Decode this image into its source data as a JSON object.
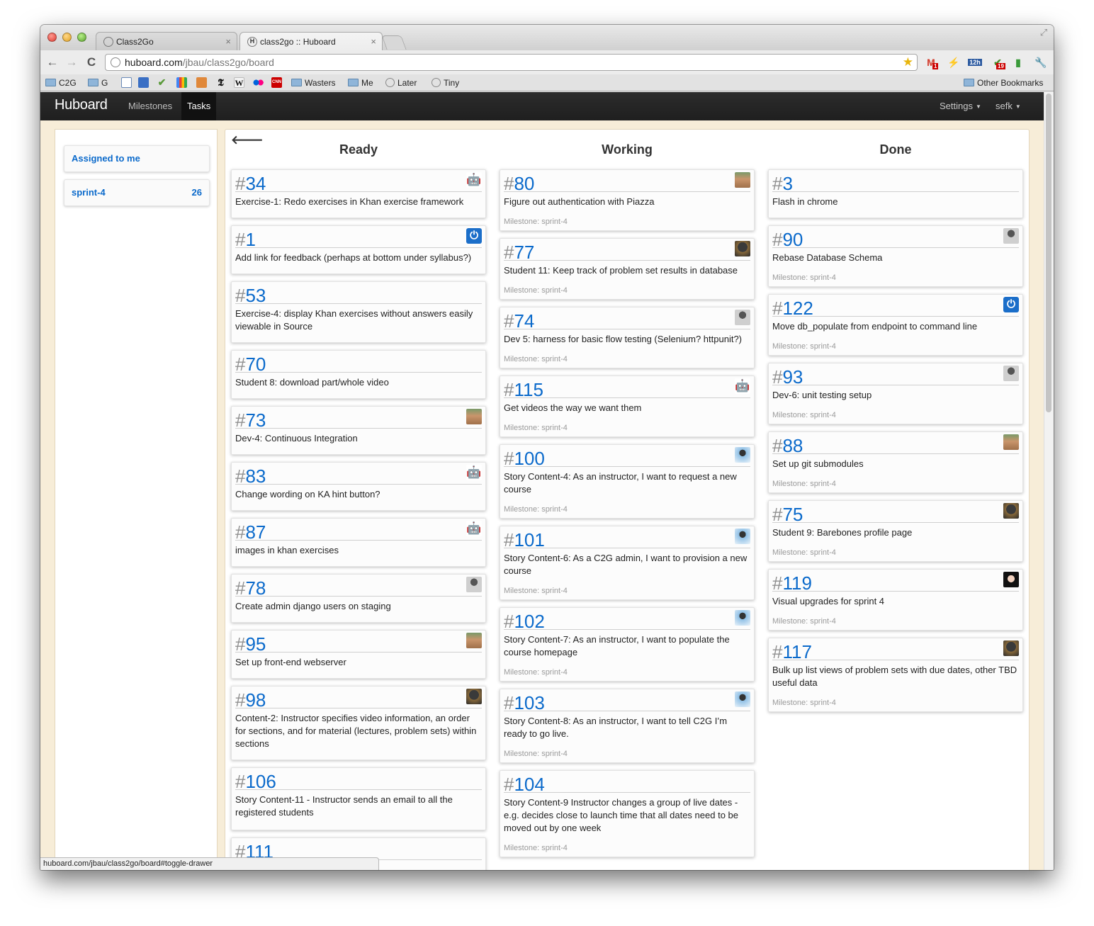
{
  "browser": {
    "tabs": [
      {
        "title": "Class2Go",
        "favicon": "globe-icon",
        "close": "×"
      },
      {
        "title": "class2go :: Huboard",
        "favicon": "H",
        "close": "×"
      }
    ],
    "fullscreen_icon": "⤢",
    "nav": {
      "back": "←",
      "forward": "→",
      "reload": "C"
    },
    "url": {
      "host": "huboard.com",
      "path": "/jbau/class2go/board"
    },
    "extension_icons": [
      "gmail-icon",
      "feather-icon",
      "calendar-icon",
      "check-icon",
      "clip-icon",
      "wrench-icon"
    ],
    "extension_badges": {
      "gmail": "1",
      "calendar": "12h",
      "check": "19"
    },
    "bookmarks": [
      {
        "label": "C2G",
        "icon": "folder-icon"
      },
      {
        "label": "G",
        "icon": "folder-icon"
      },
      {
        "label": "Wasters",
        "icon": "folder-icon"
      },
      {
        "label": "Me",
        "icon": "folder-icon"
      },
      {
        "label": "Later",
        "icon": "globe-icon"
      },
      {
        "label": "Tiny",
        "icon": "globe-icon"
      }
    ],
    "bookmark_icons": [
      "doc-icon",
      "rss-icon",
      "check-icon",
      "google-icon",
      "orange-icon",
      "nyt-icon",
      "wikipedia-icon",
      "flickr-icon",
      "cnn-icon"
    ],
    "bookmark_icon_glyphs": {
      "nyt": "𝕿",
      "wikipedia": "W",
      "cnn": "CNN"
    },
    "other_bookmarks": "Other Bookmarks",
    "status_url": "huboard.com/jbau/class2go/board#toggle-drawer"
  },
  "app": {
    "brand": "Huboard",
    "nav": {
      "milestones": "Milestones",
      "tasks": "Tasks"
    },
    "settings": "Settings",
    "user": "sefk",
    "back_arrow": "🡐",
    "filters": [
      {
        "label": "Assigned to me",
        "count": ""
      },
      {
        "label": "sprint-4",
        "count": "26"
      }
    ]
  },
  "columns": [
    {
      "title": "Ready"
    },
    {
      "title": "Working"
    },
    {
      "title": "Done"
    }
  ],
  "ready": [
    {
      "num": "34",
      "title": "Exercise-1: Redo exercises in Khan exercise framework",
      "milestone": "",
      "avatar": "robot"
    },
    {
      "num": "1",
      "title": "Add link for feedback (perhaps at bottom under syllabus?)",
      "milestone": "",
      "avatar": "power"
    },
    {
      "num": "53",
      "title": "Exercise-4: display Khan exercises without answers easily viewable in Source",
      "milestone": "",
      "avatar": ""
    },
    {
      "num": "70",
      "title": "Student 8: download part/whole video",
      "milestone": "",
      "avatar": ""
    },
    {
      "num": "73",
      "title": "Dev-4: Continuous Integration",
      "milestone": "",
      "avatar": "face"
    },
    {
      "num": "83",
      "title": "Change wording on KA hint button?",
      "milestone": "",
      "avatar": "robot"
    },
    {
      "num": "87",
      "title": "images in khan exercises",
      "milestone": "",
      "avatar": "robot"
    },
    {
      "num": "78",
      "title": "Create admin django users on staging",
      "milestone": "",
      "avatar": "person"
    },
    {
      "num": "95",
      "title": "Set up front-end webserver",
      "milestone": "",
      "avatar": "face"
    },
    {
      "num": "98",
      "title": "Content-2: Instructor specifies video information, an order for sections, and for material (lectures, problem sets) within sections",
      "milestone": "",
      "avatar": "dark"
    },
    {
      "num": "106",
      "title": "Story Content-11 - Instructor sends an email to all the registered students",
      "milestone": "",
      "avatar": ""
    },
    {
      "num": "111",
      "title": "",
      "milestone": "",
      "avatar": ""
    }
  ],
  "working": [
    {
      "num": "80",
      "title": "Figure out authentication with Piazza",
      "milestone": "Milestone: sprint-4",
      "avatar": "face"
    },
    {
      "num": "77",
      "title": "Student 11: Keep track of problem set results in database",
      "milestone": "Milestone: sprint-4",
      "avatar": "dark"
    },
    {
      "num": "74",
      "title": "Dev 5: harness for basic flow testing (Selenium? httpunit?)",
      "milestone": "Milestone: sprint-4",
      "avatar": "person"
    },
    {
      "num": "115",
      "title": "Get videos the way we want them",
      "milestone": "Milestone: sprint-4",
      "avatar": "robot"
    },
    {
      "num": "100",
      "title": "Story Content-4: As an instructor, I want to request a new course",
      "milestone": "Milestone: sprint-4",
      "avatar": "blue"
    },
    {
      "num": "101",
      "title": "Story Content-6: As a C2G admin, I want to provision a new course",
      "milestone": "Milestone: sprint-4",
      "avatar": "blue"
    },
    {
      "num": "102",
      "title": "Story Content-7: As an instructor, I want to populate the course homepage",
      "milestone": "Milestone: sprint-4",
      "avatar": "blue"
    },
    {
      "num": "103",
      "title": "Story Content-8: As an instructor, I want to tell C2G I’m ready to go live.",
      "milestone": "Milestone: sprint-4",
      "avatar": "blue"
    },
    {
      "num": "104",
      "title": "Story Content-9 Instructor changes a group of live dates - e.g. decides close to launch time that all dates need to be moved out by one week",
      "milestone": "Milestone: sprint-4",
      "avatar": ""
    }
  ],
  "done": [
    {
      "num": "3",
      "title": "Flash in chrome",
      "milestone": "",
      "avatar": ""
    },
    {
      "num": "90",
      "title": "Rebase Database Schema",
      "milestone": "Milestone: sprint-4",
      "avatar": "person"
    },
    {
      "num": "122",
      "title": "Move db_populate from endpoint to command line",
      "milestone": "Milestone: sprint-4",
      "avatar": "power"
    },
    {
      "num": "93",
      "title": "Dev-6: unit testing setup",
      "milestone": "Milestone: sprint-4",
      "avatar": "person"
    },
    {
      "num": "88",
      "title": "Set up git submodules",
      "milestone": "Milestone: sprint-4",
      "avatar": "face"
    },
    {
      "num": "75",
      "title": "Student 9: Barebones profile page",
      "milestone": "Milestone: sprint-4",
      "avatar": "dark"
    },
    {
      "num": "119",
      "title": "Visual upgrades for sprint 4",
      "milestone": "Milestone: sprint-4",
      "avatar": "girl"
    },
    {
      "num": "117",
      "title": "Bulk up list views of problem sets with due dates, other TBD useful data",
      "milestone": "Milestone: sprint-4",
      "avatar": "dark"
    }
  ]
}
